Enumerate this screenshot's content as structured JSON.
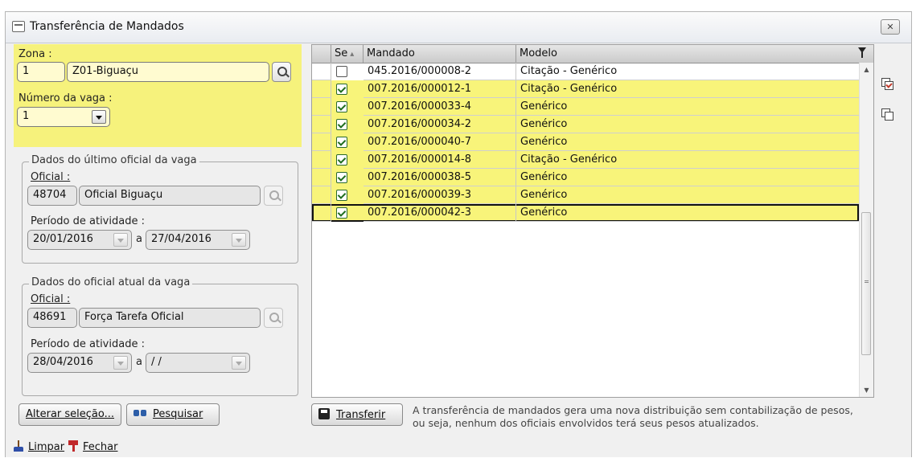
{
  "window": {
    "title": "Transferência de Mandados"
  },
  "zona": {
    "label": "Zona :",
    "code": "1",
    "name": "Z01-Biguaçu"
  },
  "vaga": {
    "label": "Número da vaga :",
    "value": "1"
  },
  "ultimo": {
    "legend": "Dados do último oficial da vaga",
    "oficial_label": "Oficial :",
    "oficial_code": "48704",
    "oficial_name": "Oficial Biguaçu",
    "periodo_label": "Período de atividade :",
    "de": "20/01/2016",
    "sep": "a",
    "ate": "27/04/2016"
  },
  "atual": {
    "legend": "Dados do oficial atual da vaga",
    "oficial_label": "Oficial :",
    "oficial_code": "48691",
    "oficial_name": "Força Tarefa Oficial",
    "periodo_label": "Período de atividade :",
    "de": "28/04/2016",
    "sep": "a",
    "ate": "/ /"
  },
  "buttons": {
    "alterar": "Alterar seleção...",
    "pesquisar": "Pesquisar",
    "transferir": "Transferir"
  },
  "grid": {
    "columns": [
      "Se",
      "Mandado",
      "Modelo"
    ],
    "rows": [
      {
        "checked": false,
        "mandado": "045.2016/000008-2",
        "modelo": "Citação - Genérico"
      },
      {
        "checked": true,
        "mandado": "007.2016/000012-1",
        "modelo": "Citação - Genérico"
      },
      {
        "checked": true,
        "mandado": "007.2016/000033-4",
        "modelo": "Genérico"
      },
      {
        "checked": true,
        "mandado": "007.2016/000034-2",
        "modelo": "Genérico"
      },
      {
        "checked": true,
        "mandado": "007.2016/000040-7",
        "modelo": "Genérico"
      },
      {
        "checked": true,
        "mandado": "007.2016/000014-8",
        "modelo": "Citação - Genérico"
      },
      {
        "checked": true,
        "mandado": "007.2016/000038-5",
        "modelo": "Genérico"
      },
      {
        "checked": true,
        "mandado": "007.2016/000039-3",
        "modelo": "Genérico"
      },
      {
        "checked": true,
        "mandado": "007.2016/000042-3",
        "modelo": "Genérico"
      }
    ]
  },
  "note": "A transferência de mandados gera uma nova distribuição sem contabilização de pesos, ou seja, nenhum dos oficiais envolvidos terá seus pesos atualizados.",
  "bottom": {
    "limpar": "Limpar",
    "fechar": "Fechar"
  },
  "colors": {
    "highlight": "#f8f47a",
    "zone": "#f6f27c",
    "field": "#fffbd0"
  },
  "icons": [
    "window-icon",
    "close-icon",
    "search-icon",
    "chevron-down-icon",
    "binoculars-icon",
    "filter-icon",
    "select-all-icon",
    "copy-icon",
    "save-icon",
    "broom-icon",
    "exit-icon"
  ]
}
